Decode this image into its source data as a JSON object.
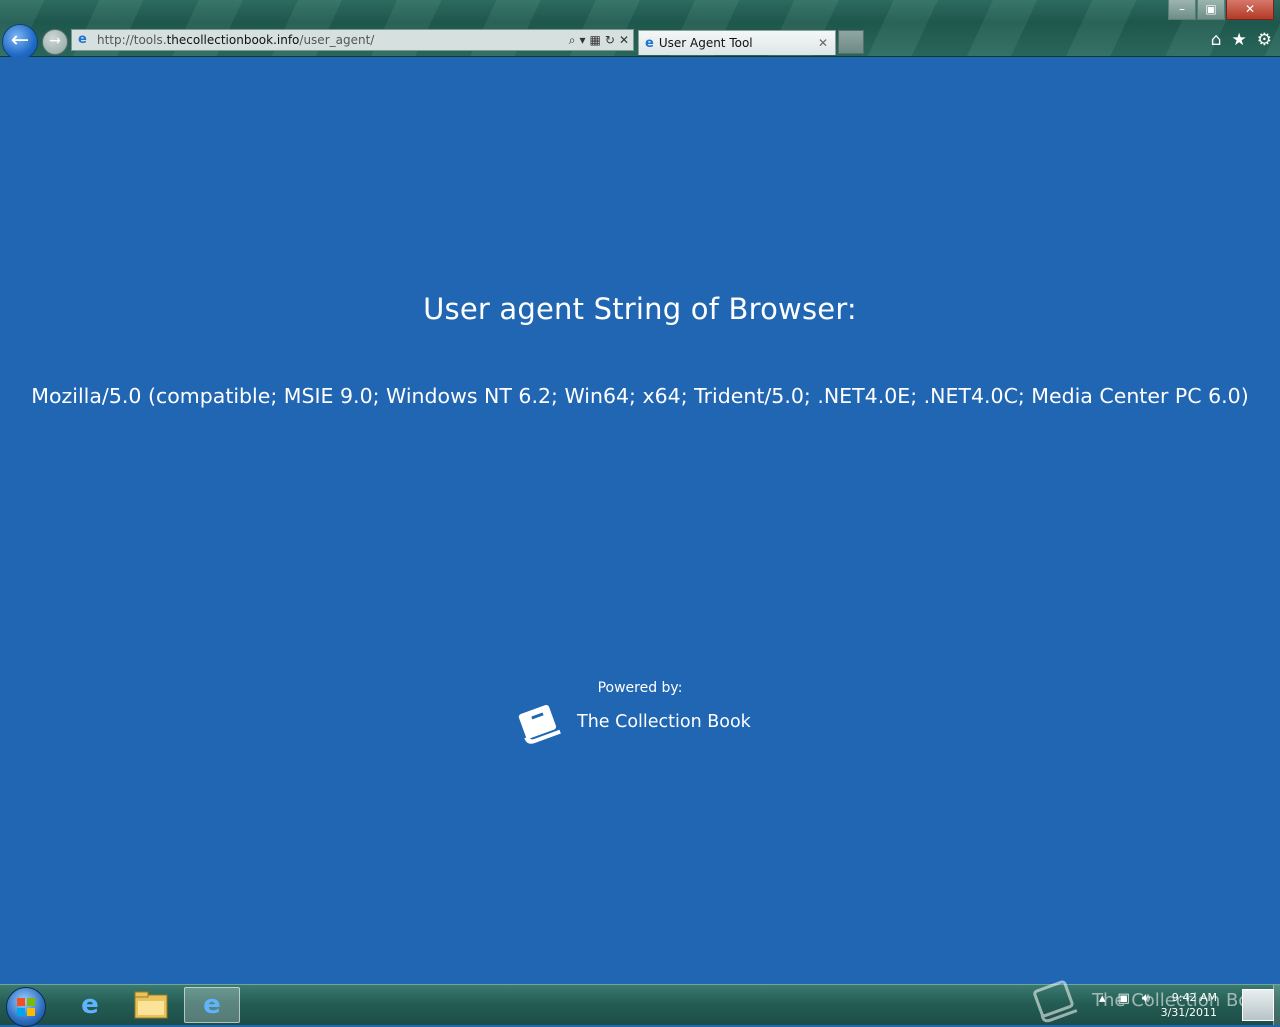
{
  "browser": {
    "address": {
      "prefix": "http://tools.",
      "domain": "thecollectionbook.info",
      "path": "/user_agent/"
    },
    "tab": {
      "title": "User Agent Tool"
    },
    "window_buttons": {
      "minimize": "–",
      "restore": "▣",
      "close": "✕"
    }
  },
  "page": {
    "heading": "User agent String of Browser:",
    "user_agent": "Mozilla/5.0 (compatible; MSIE 9.0; Windows NT 6.2; Win64; x64; Trident/5.0; .NET4.0E; .NET4.0C; Media Center PC 6.0)",
    "powered_by": "Powered by:",
    "brand_name": "The Collection Book"
  },
  "taskbar": {
    "clock_time": "9:42 AM",
    "clock_date": "3/31/2011",
    "watermark": "The Collection Book",
    "pinned": [
      "internet-explorer",
      "file-explorer",
      "internet-explorer-active"
    ]
  },
  "colors": {
    "page_background": "#2066b3",
    "accent_ie": "#1f74d4"
  }
}
